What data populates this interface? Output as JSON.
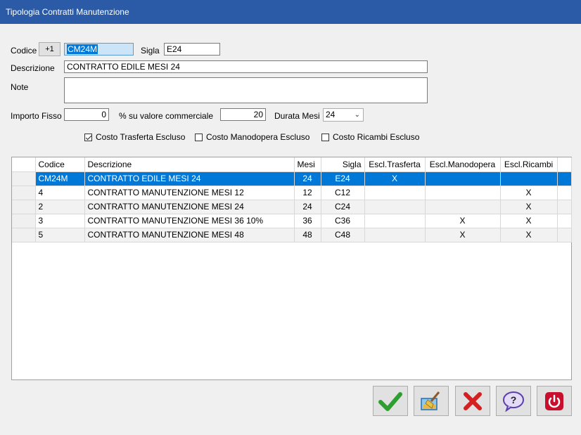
{
  "window": {
    "title": "Tipologia Contratti Manutenzione"
  },
  "form": {
    "codice_label": "Codice",
    "codice_increment": "+1",
    "codice_value": "CM24M",
    "sigla_label": "Sigla",
    "sigla_value": "E24",
    "descrizione_label": "Descrizione",
    "descrizione_value": "CONTRATTO EDILE MESI 24",
    "note_label": "Note",
    "note_value": "",
    "importo_label": "Importo Fisso",
    "importo_value": "0",
    "percent_label": "% su valore commerciale",
    "percent_value": "20",
    "durata_label": "Durata Mesi",
    "durata_value": "24",
    "chk_trasferta_label": "Costo Trasferta Escluso",
    "chk_trasferta_checked": true,
    "chk_manodopera_label": "Costo Manodopera Escluso",
    "chk_manodopera_checked": false,
    "chk_ricambi_label": "Costo Ricambi Escluso",
    "chk_ricambi_checked": false
  },
  "grid": {
    "headers": [
      "Codice",
      "Descrizione",
      "Mesi",
      "Sigla",
      "Escl.Trasferta",
      "Escl.Manodopera",
      "Escl.Ricambi"
    ],
    "rows": [
      [
        "CM24M",
        "CONTRATTO EDILE MESI 24",
        "24",
        "E24",
        "X",
        "",
        ""
      ],
      [
        "4",
        "CONTRATTO MANUTENZIONE MESI 12",
        "12",
        "C12",
        "",
        "",
        "X"
      ],
      [
        "2",
        "CONTRATTO MANUTENZIONE MESI 24",
        "24",
        "C24",
        "",
        "",
        "X"
      ],
      [
        "3",
        "CONTRATTO MANUTENZIONE MESI 36 10%",
        "36",
        "C36",
        "",
        "X",
        "X"
      ],
      [
        "5",
        "CONTRATTO MANUTENZIONE MESI 48",
        "48",
        "C48",
        "",
        "X",
        "X"
      ]
    ],
    "selected_row": 0
  },
  "toolbar": {
    "icons": [
      "checkmark-icon",
      "broom-icon",
      "red-x-icon",
      "help-icon",
      "power-icon"
    ]
  },
  "colors": {
    "titlebar": "#2b5ba6",
    "selection": "#0078d7",
    "confirm": "#2e9e2e",
    "cancel": "#d42020",
    "power": "#c8102e"
  }
}
